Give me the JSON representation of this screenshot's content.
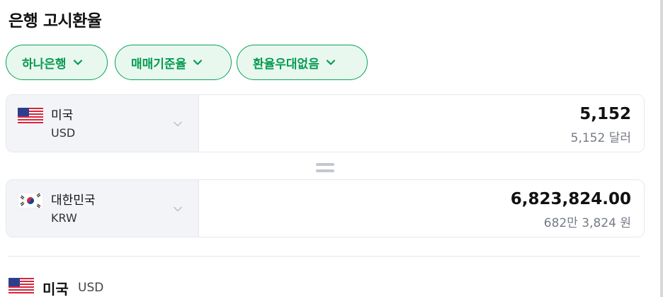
{
  "page": {
    "title": "은행 고시환율"
  },
  "filters": [
    {
      "label": "하나은행"
    },
    {
      "label": "매매기준율"
    },
    {
      "label": "환율우대없음"
    }
  ],
  "from": {
    "name": "미국",
    "code": "USD",
    "amount": "5,152",
    "amount_text": "5,152 달러",
    "flag": "us-flag-icon"
  },
  "to": {
    "name": "대한민국",
    "code": "KRW",
    "amount": "6,823,824.00",
    "amount_text": "682만 3,824 원",
    "flag": "kr-flag-icon"
  },
  "detail": {
    "name": "미국",
    "code": "USD"
  },
  "colors": {
    "accent": "#079b51",
    "pill_bg": "#e9f8ef",
    "border": "#e6e8ec",
    "muted": "#767b86"
  }
}
